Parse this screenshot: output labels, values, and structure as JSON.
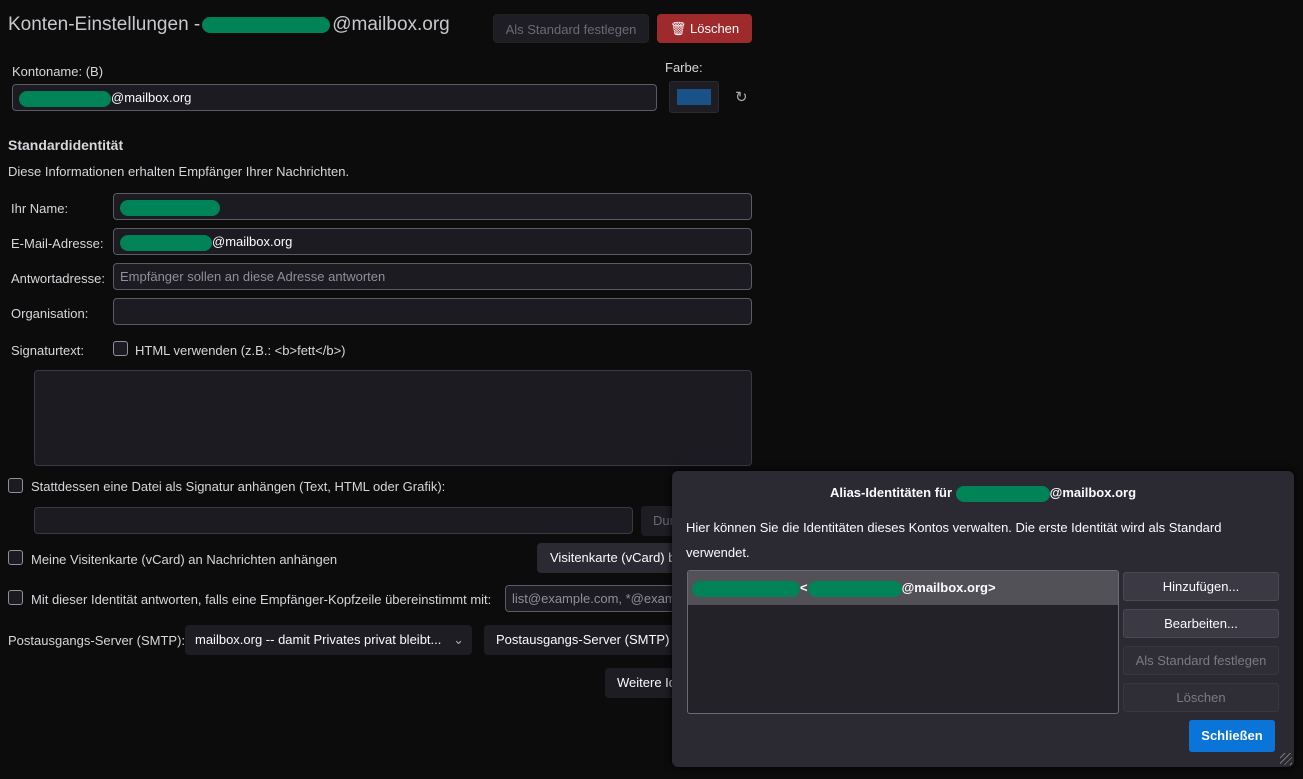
{
  "header": {
    "title_prefix": "Konten-Einstellungen -",
    "title_suffix": "@mailbox.org",
    "set_default": "Als Standard festlegen",
    "delete": "Löschen"
  },
  "account": {
    "name_label": "Kontoname: (B)",
    "name_suffix": "@mailbox.org",
    "color_label": "Farbe:",
    "color": "#1a5186"
  },
  "identity": {
    "heading": "Standardidentität",
    "description": "Diese Informationen erhalten Empfänger Ihrer Nachrichten.",
    "name_label": "Ihr Name:",
    "email_label": "E-Mail-Adresse:",
    "email_suffix": "@mailbox.org",
    "reply_label": "Antwortadresse:",
    "reply_placeholder": "Empfänger sollen an diese Adresse antworten",
    "org_label": "Organisation:",
    "sig_label": "Signaturtext:",
    "html_label": "HTML verwenden (z.B.: <b>fett</b>)",
    "file_sig_label": "Stattdessen eine Datei als Signatur anhängen (Text, HTML oder Grafik):",
    "browse": "Durchsuchen...",
    "vcard_label": "Meine Visitenkarte (vCard) an Nachrichten anhängen",
    "vcard_button": "Visitenkarte (vCard) bearbeiten...",
    "reply_match_label": "Mit dieser Identität antworten, falls eine Empfänger-Kopfzeile übereinstimmt mit:",
    "reply_match_placeholder": "list@example.com, *@example.com",
    "smtp_label": "Postausgangs-Server (SMTP):",
    "smtp_value": "mailbox.org -- damit Privates privat bleibt...",
    "smtp_button": "Postausgangs-Server (SMTP) bearbeiten...",
    "more_identities": "Weitere Identitäten..."
  },
  "dialog": {
    "title_prefix": "Alias-Identitäten für",
    "title_suffix": "@mailbox.org",
    "description": "Hier können Sie die Identitäten dieses Kontos verwalten. Die erste Identität wird als Standard verwendet.",
    "items": [
      {
        "open": "<",
        "suffix": "@mailbox.org>"
      }
    ],
    "add": "Hinzufügen...",
    "edit": "Bearbeiten...",
    "set_default": "Als Standard festlegen",
    "delete": "Löschen",
    "close": "Schließen"
  }
}
